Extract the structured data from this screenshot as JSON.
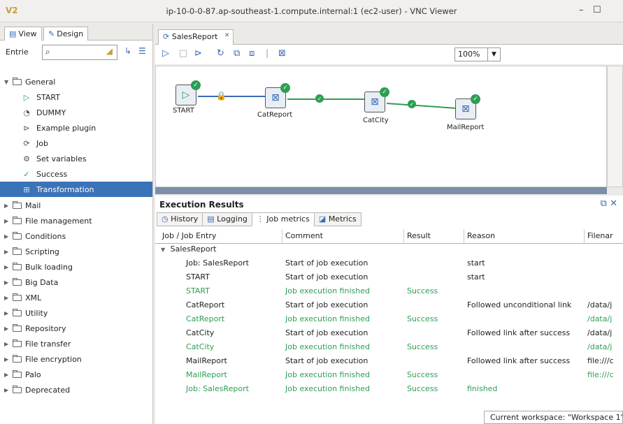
{
  "window": {
    "title": "ip-10-0-0-87.ap-southeast-1.compute.internal:1 (ec2-user) - VNC Viewer",
    "minimize": "–",
    "maximize": "☐"
  },
  "left_panel": {
    "tabs": [
      "View",
      "Design"
    ],
    "filter_label": "Entrie",
    "tree": {
      "general": {
        "label": "General",
        "items": [
          "START",
          "DUMMY",
          "Example plugin",
          "Job",
          "Set variables",
          "Success",
          "Transformation"
        ]
      },
      "folders": [
        "Mail",
        "File management",
        "Conditions",
        "Scripting",
        "Bulk loading",
        "Big Data",
        "XML",
        "Utility",
        "Repository",
        "File transfer",
        "File encryption",
        "Palo",
        "Deprecated"
      ]
    }
  },
  "editor": {
    "tab_label": "SalesReport",
    "zoom": "100%",
    "steps": {
      "start": "START",
      "catreport": "CatReport",
      "catcity": "CatCity",
      "mailreport": "MailReport"
    }
  },
  "results": {
    "title": "Execution Results",
    "tabs": [
      "History",
      "Logging",
      "Job metrics",
      "Metrics"
    ],
    "columns": [
      "Job / Job Entry",
      "Comment",
      "Result",
      "Reason",
      "Filenar"
    ],
    "root": "SalesReport",
    "rows": [
      {
        "entry": "Job: SalesReport",
        "comment": "Start of job execution",
        "result": "",
        "reason": "start",
        "file": "",
        "ok": false
      },
      {
        "entry": "START",
        "comment": "Start of job execution",
        "result": "",
        "reason": "start",
        "file": "",
        "ok": false
      },
      {
        "entry": "START",
        "comment": "Job execution finished",
        "result": "Success",
        "reason": "",
        "file": "",
        "ok": true
      },
      {
        "entry": "CatReport",
        "comment": "Start of job execution",
        "result": "",
        "reason": "Followed unconditional link",
        "file": "/data/j",
        "ok": false
      },
      {
        "entry": "CatReport",
        "comment": "Job execution finished",
        "result": "Success",
        "reason": "",
        "file": "/data/j",
        "ok": true
      },
      {
        "entry": "CatCity",
        "comment": "Start of job execution",
        "result": "",
        "reason": "Followed link after success",
        "file": "/data/j",
        "ok": false
      },
      {
        "entry": "CatCity",
        "comment": "Job execution finished",
        "result": "Success",
        "reason": "",
        "file": "/data/j",
        "ok": true
      },
      {
        "entry": "MailReport",
        "comment": "Start of job execution",
        "result": "",
        "reason": "Followed link after success",
        "file": "file:///c",
        "ok": false
      },
      {
        "entry": "MailReport",
        "comment": "Job execution finished",
        "result": "Success",
        "reason": "",
        "file": "file:///c",
        "ok": true
      },
      {
        "entry": "Job: SalesReport",
        "comment": "Job execution finished",
        "result": "Success",
        "reason": "finished",
        "file": "",
        "ok": true
      }
    ]
  },
  "status_bar": {
    "text": "Current workspace: \"Workspace 1\""
  },
  "colors": {
    "success": "#2e9e54",
    "selection": "#3b73b9",
    "accent": "#3b6bb5"
  }
}
